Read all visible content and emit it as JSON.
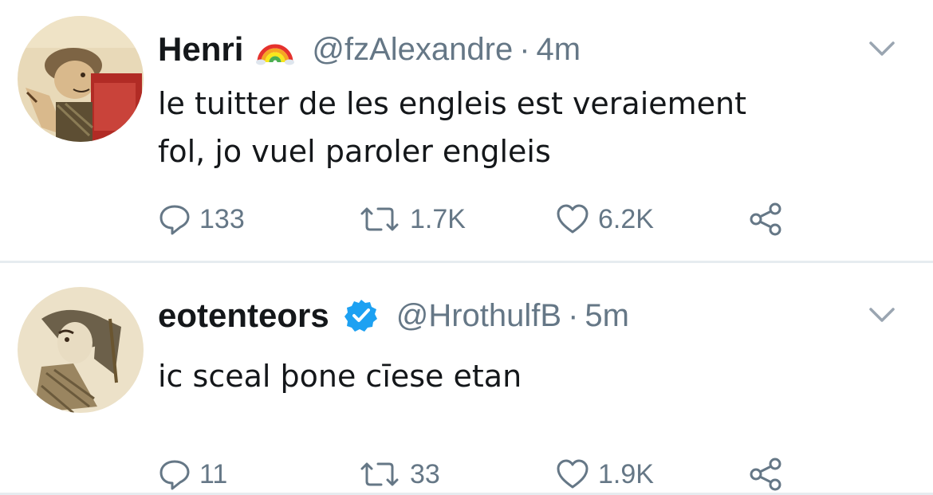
{
  "tweets": [
    {
      "display_name": "Henri",
      "name_icon": "rainbow-emoji-icon",
      "handle": "@fzAlexandre",
      "separator": "·",
      "time": "4m",
      "text": "le tuitter de les engleis est veraiement\nfol, jo vuel paroler engleis",
      "replies": "133",
      "retweets": "1.7K",
      "likes": "6.2K"
    },
    {
      "display_name": "eotenteors",
      "name_icon": "verified-badge-icon",
      "handle": "@HrothulfB",
      "separator": "·",
      "time": "5m",
      "text": "ic sceal þone cīese etan",
      "replies": "11",
      "retweets": "33",
      "likes": "1.9K"
    }
  ],
  "colors": {
    "text": "#14171a",
    "muted": "#657786",
    "verified": "#1da1f2",
    "divider": "#e6ecf0"
  }
}
